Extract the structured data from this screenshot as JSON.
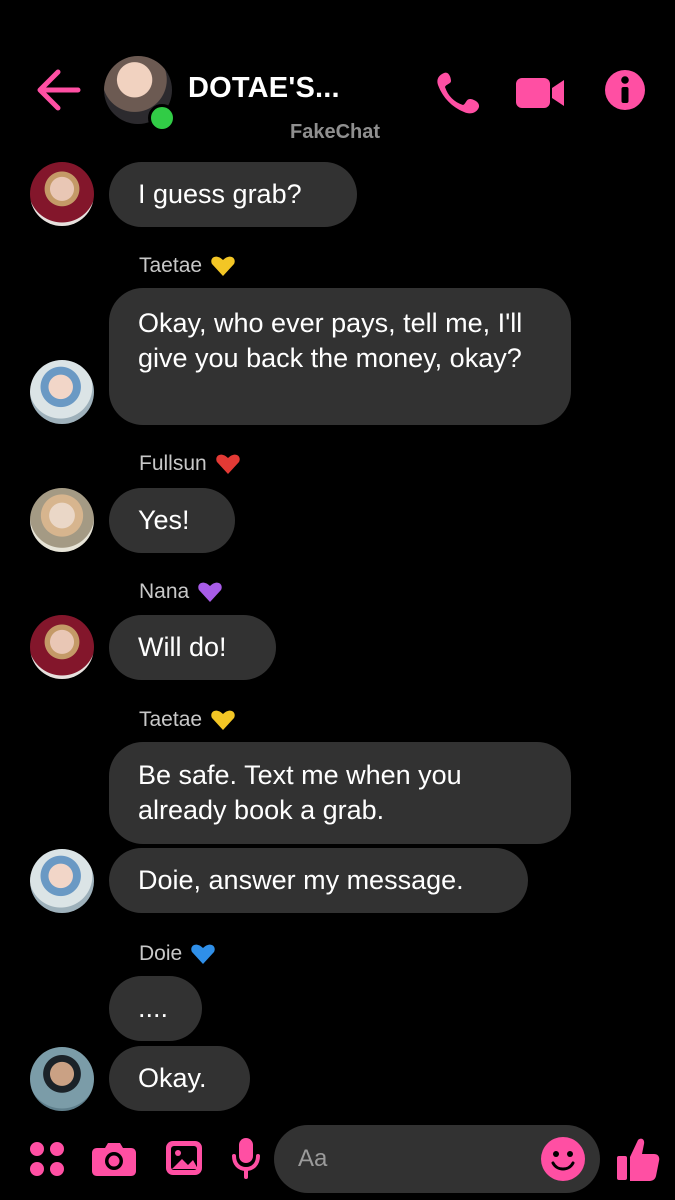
{
  "header": {
    "title": "DOTAE'S...",
    "watermark": "FakeChat",
    "online": true,
    "icons": [
      "back-arrow-icon",
      "phone-icon",
      "video-call-icon",
      "info-icon"
    ]
  },
  "colors": {
    "accent": "#ff4fa3",
    "background": "#000000",
    "bubble": "#323232",
    "online": "#31cc46"
  },
  "messages": [
    {
      "sender": "",
      "text": "I guess grab?"
    },
    {
      "sender": "Taetae",
      "heart": "yellow",
      "text": "Okay,  who ever pays, tell me, I'll give you back the money, okay?"
    },
    {
      "sender": "Fullsun",
      "heart": "red",
      "text": "Yes!"
    },
    {
      "sender": "Nana",
      "heart": "purple",
      "text": "Will do!"
    },
    {
      "sender": "Taetae",
      "heart": "yellow",
      "text": "Be safe.  Text me when you already book a grab."
    },
    {
      "sender": "",
      "text": "Doie, answer my message."
    },
    {
      "sender": "Doie",
      "heart": "blue",
      "text": "...."
    },
    {
      "sender": "",
      "text": "Okay."
    }
  ],
  "composer": {
    "placeholder": "Aa",
    "icons": [
      "apps-icon",
      "camera-icon",
      "gallery-icon",
      "microphone-icon",
      "emoji-icon",
      "thumbs-up-icon"
    ]
  }
}
